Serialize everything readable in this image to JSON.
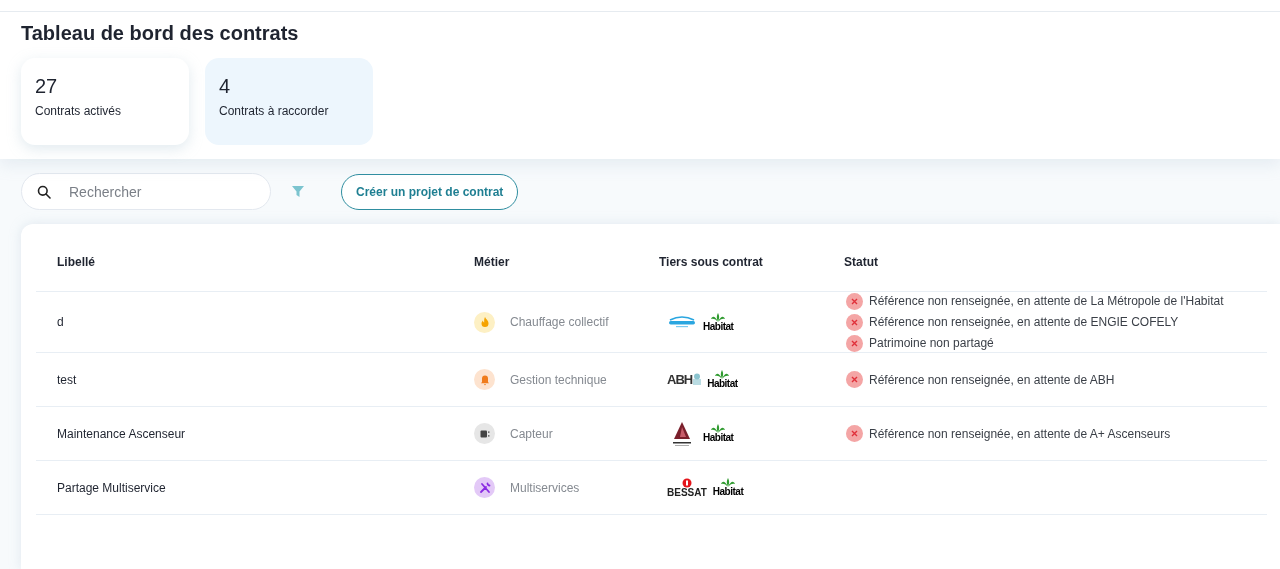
{
  "title": "Tableau de bord des contrats",
  "stats": [
    {
      "value": "27",
      "label": "Contrats activés",
      "selected": false
    },
    {
      "value": "4",
      "label": "Contrats à raccorder",
      "selected": true
    }
  ],
  "search": {
    "placeholder": "Rechercher"
  },
  "create_button": "Créer un projet de contrat",
  "table": {
    "columns": [
      "Libellé",
      "Métier",
      "Tiers sous contrat",
      "Statut"
    ],
    "rows": [
      {
        "label": "d",
        "metier": {
          "kind": "fire",
          "text": "Chauffage collectif"
        },
        "tiers": [
          {
            "kind": "engie"
          },
          {
            "kind": "habitat",
            "text": "Habitat"
          }
        ],
        "statut": [
          {
            "kind": "error",
            "text": "Référence non renseignée, en attente de La Métropole de l'Habitat"
          },
          {
            "kind": "error",
            "text": "Référence non renseignée, en attente de ENGIE COFELY"
          },
          {
            "kind": "error",
            "text": "Patrimoine non partagé"
          }
        ]
      },
      {
        "label": "test",
        "metier": {
          "kind": "bell",
          "text": "Gestion technique"
        },
        "tiers": [
          {
            "kind": "abh",
            "text": "ABH"
          },
          {
            "kind": "habitat",
            "text": "Habitat"
          }
        ],
        "statut": [
          {
            "kind": "error",
            "text": "Référence non renseignée, en attente de ABH"
          }
        ]
      },
      {
        "label": "Maintenance Ascenseur",
        "metier": {
          "kind": "sensor",
          "text": "Capteur"
        },
        "tiers": [
          {
            "kind": "aplus"
          },
          {
            "kind": "habitat",
            "text": "Habitat"
          }
        ],
        "statut": [
          {
            "kind": "error",
            "text": "Référence non renseignée, en attente de A+ Ascenseurs"
          }
        ]
      },
      {
        "label": "Partage Multiservice",
        "metier": {
          "kind": "tools",
          "text": "Multiservices"
        },
        "tiers": [
          {
            "kind": "bessat",
            "text": "BESSAT"
          },
          {
            "kind": "habitat",
            "text": "Habitat"
          }
        ],
        "statut": []
      }
    ]
  }
}
